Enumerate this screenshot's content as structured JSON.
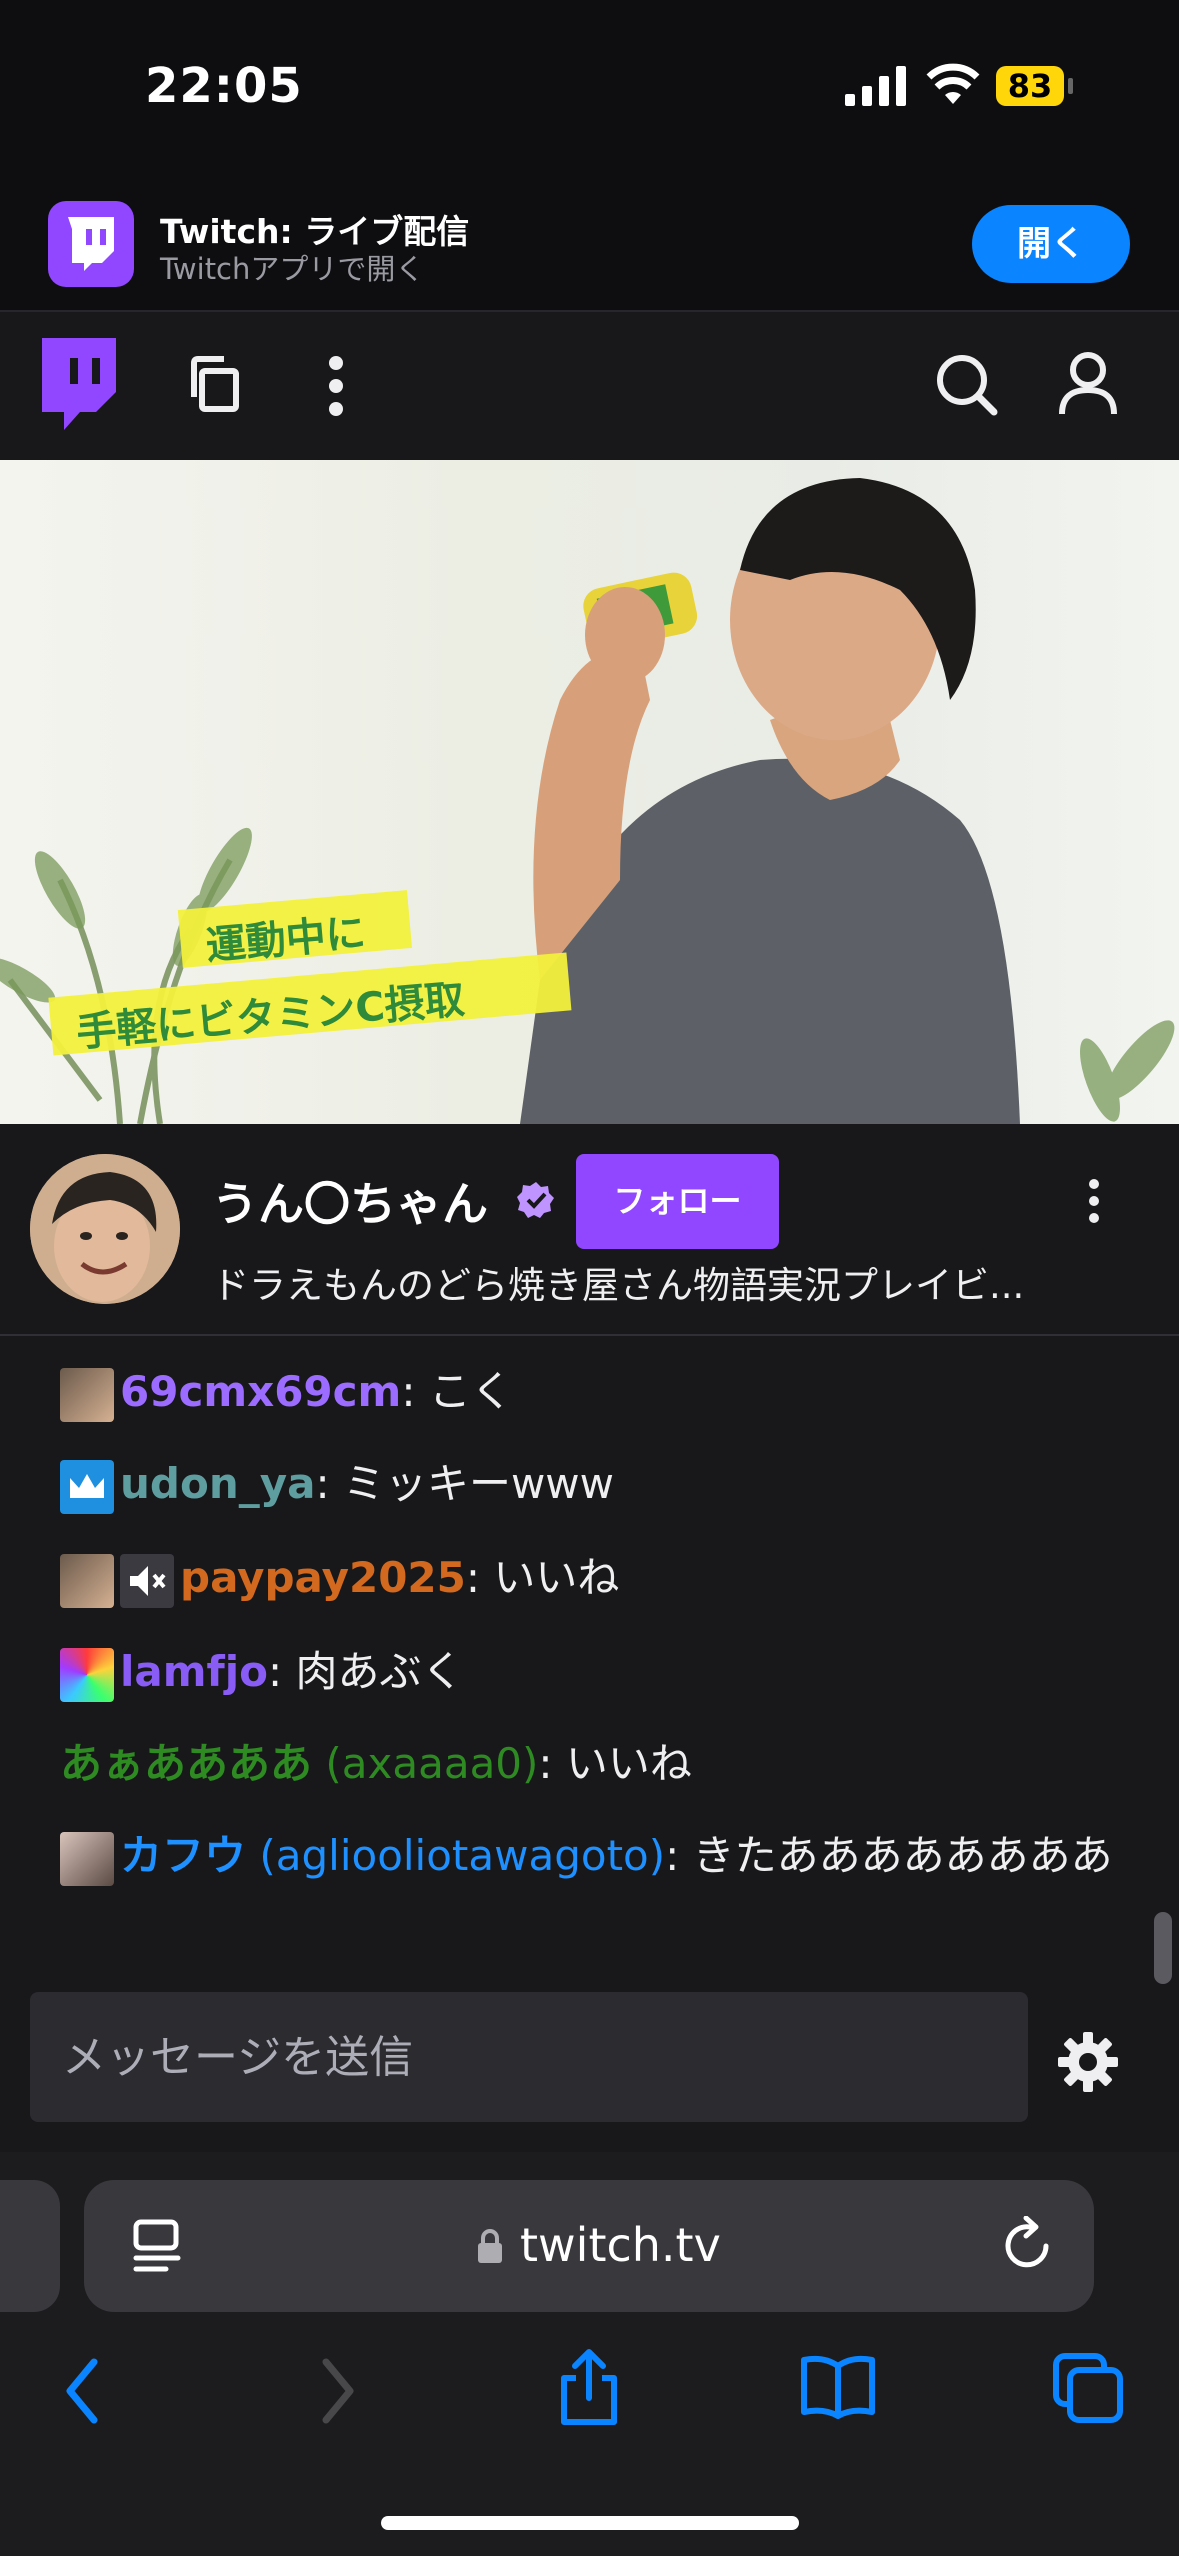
{
  "status_bar": {
    "time": "22:05",
    "battery": "83"
  },
  "app_banner": {
    "title": "Twitch: ライブ配信",
    "subtitle": "Twitchアプリで開く",
    "open_label": "開く"
  },
  "video": {
    "caption_line1": "運動中に",
    "caption_line2": "手軽にビタミンC摂取"
  },
  "channel": {
    "name": "うん〇ちゃん",
    "follow_label": "フォロー",
    "stream_title": "ドラえもんのどら焼き屋さん物語実況プレイビ..."
  },
  "chat": {
    "messages": [
      {
        "user": "69cmx69cm",
        "login": "",
        "text": ": こく",
        "color": "#9c6bff"
      },
      {
        "user": "udon_ya",
        "login": "",
        "text": ": ミッキーwww",
        "color": "#5f9ea0"
      },
      {
        "user": "paypay2025",
        "login": "",
        "text": ": いいね",
        "color": "#d2691e"
      },
      {
        "user": "lamfjo",
        "login": "",
        "text": ": 肉あぶく",
        "color": "#8a5cf6"
      },
      {
        "user": "あぁああああ",
        "login": "(axaaaa0)",
        "text": ": いいね",
        "color": "#2e8b22"
      },
      {
        "user": "カフウ",
        "login": "(aglioolio­tawagoto)",
        "text": ": きたああああああああ",
        "color": "#1e90ff"
      }
    ],
    "input_placeholder": "メッセージを送信"
  },
  "browser": {
    "url": "twitch.tv"
  },
  "colors": {
    "twitch_purple": "#9146ff",
    "ios_blue": "#0a84ff",
    "battery_yellow": "#ffd60a"
  }
}
